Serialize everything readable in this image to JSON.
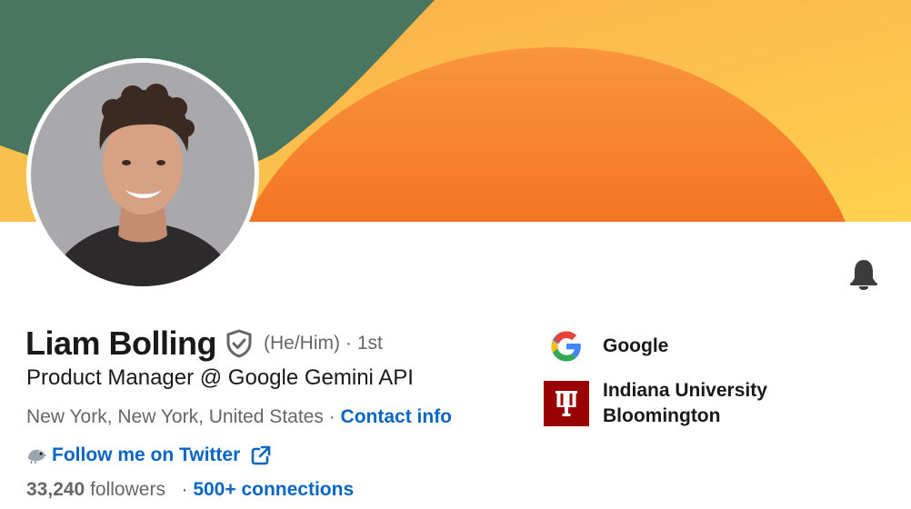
{
  "profile": {
    "name": "Liam Bolling",
    "pronouns": "(He/Him)",
    "degree": "· 1st",
    "headline": "Product Manager @ Google Gemini API",
    "location": "New York, New York, United States",
    "separator": "·",
    "contact_label": "Contact info",
    "website_label": "Follow me on Twitter",
    "followers_count": "33,240",
    "followers_label": "followers",
    "connections_label": "500+ connections"
  },
  "organizations": [
    {
      "name": "Google",
      "icon": "google-logo"
    },
    {
      "name_line1": "Indiana University",
      "name_line2": "Bloomington",
      "icon": "iu-trident-logo"
    }
  ],
  "icons": {
    "verified": "shield-check-icon",
    "notifications": "bell-icon",
    "twitter": "bird-icon",
    "external_link": "external-link-icon"
  },
  "colors": {
    "link": "#0a66c2",
    "banner_green": "#4a7560",
    "banner_orange": "#f58a36",
    "banner_yellow": "#fbbd4a",
    "iu_crimson": "#990000"
  }
}
